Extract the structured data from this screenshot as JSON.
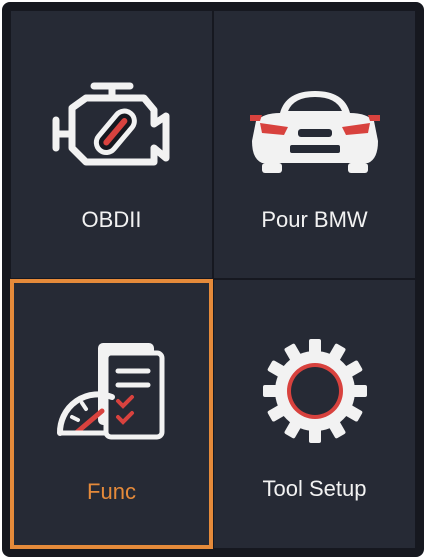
{
  "menu": {
    "items": [
      {
        "label": "OBDII",
        "icon": "engine-icon"
      },
      {
        "label": "Pour BMW",
        "icon": "car-front-icon"
      },
      {
        "label": "Func",
        "icon": "function-document-icon",
        "selected": true
      },
      {
        "label": "Tool Setup",
        "icon": "gear-icon"
      }
    ]
  },
  "colors": {
    "background": "#16181f",
    "tile": "#262a35",
    "accent": "#e58a3a",
    "icon_red": "#d8423e",
    "text": "#f2f2f2"
  }
}
